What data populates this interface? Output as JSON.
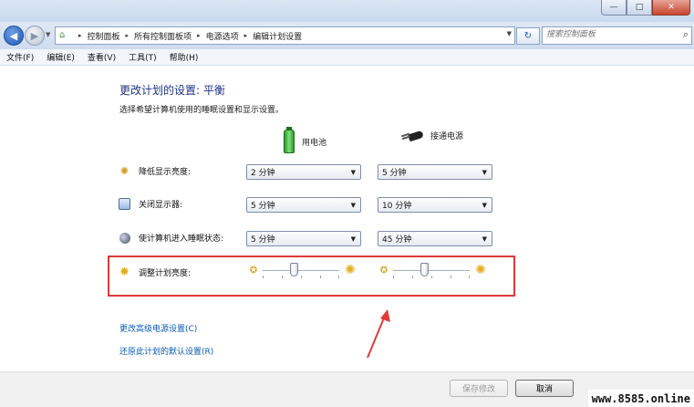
{
  "window": {
    "minimize_glyph": "—",
    "maximize_glyph": "□",
    "close_glyph": "✕"
  },
  "address": {
    "crumbs": [
      "控制面板",
      "所有控制面板项",
      "电源选项",
      "编辑计划设置"
    ],
    "separator": "▸",
    "search_placeholder": "搜索控制面板"
  },
  "menu": {
    "items": [
      "文件(F)",
      "编辑(E)",
      "查看(V)",
      "工具(T)",
      "帮助(H)"
    ]
  },
  "plan": {
    "title": "更改计划的设置: 平衡",
    "subtitle": "选择希望计算机使用的睡眠设置和显示设置。",
    "col_battery": "用电池",
    "col_plugged": "接通电源"
  },
  "settings": [
    {
      "label": "降低显示亮度:",
      "icon": "brightness-sun-icon",
      "battery": "2 分钟",
      "plugged": "5 分钟"
    },
    {
      "label": "关闭显示器:",
      "icon": "monitor-icon",
      "battery": "5 分钟",
      "plugged": "10 分钟"
    },
    {
      "label": "使计算机进入睡眠状态:",
      "icon": "sleep-moon-icon",
      "battery": "5 分钟",
      "plugged": "45 分钟"
    }
  ],
  "brightness": {
    "label": "调整计划亮度:",
    "battery_level": 0.4,
    "plugged_level": 0.4
  },
  "links": {
    "advanced": "更改高级电源设置(C)",
    "restore": "还原此计划的默认设置(R)"
  },
  "buttons": {
    "save": "保存修改",
    "cancel": "取消"
  },
  "watermark": "www.8585.online",
  "colors": {
    "title": "#1e3287",
    "link": "#0b5bb7",
    "highlight": "#e03a3a"
  }
}
